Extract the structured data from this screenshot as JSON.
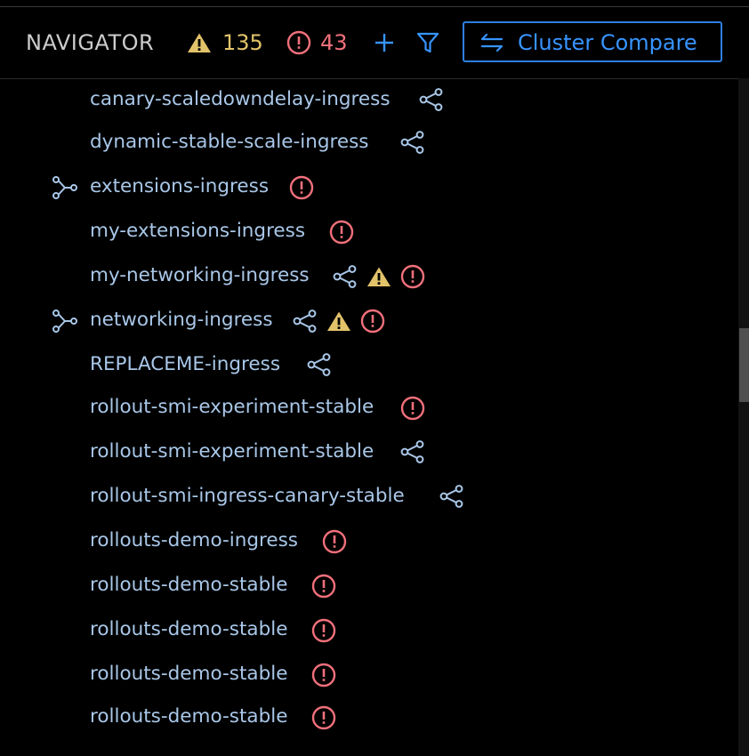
{
  "header": {
    "title": "NAVIGATOR",
    "warning_count": "135",
    "error_count": "43",
    "add_icon": "plus-icon",
    "filter_icon": "filter-icon",
    "cluster_compare_label": "Cluster Compare",
    "cluster_compare_icon": "swap-arrows-icon"
  },
  "colors": {
    "background": "#000000",
    "accent": "#3794ff",
    "warning": "#e2c36a",
    "error": "#f1707b",
    "item_text": "#a9c7e8",
    "title_text": "#cccccc"
  },
  "items": [
    {
      "label": "canary-scaledowndelay-ingress",
      "expandable": false,
      "icons": [
        "share-icon"
      ]
    },
    {
      "label": "dynamic-stable-scale-ingress",
      "expandable": false,
      "icons": [
        "share-icon"
      ]
    },
    {
      "label": "extensions-ingress",
      "expandable": true,
      "icons": [
        "error-icon"
      ]
    },
    {
      "label": "my-extensions-ingress",
      "expandable": false,
      "icons": [
        "error-icon"
      ]
    },
    {
      "label": "my-networking-ingress",
      "expandable": false,
      "icons": [
        "share-icon",
        "warning-icon",
        "error-icon"
      ]
    },
    {
      "label": "networking-ingress",
      "expandable": true,
      "icons": [
        "share-icon",
        "warning-icon",
        "error-icon"
      ]
    },
    {
      "label": "REPLACEME-ingress",
      "expandable": false,
      "icons": [
        "share-icon"
      ]
    },
    {
      "label": "rollout-smi-experiment-stable",
      "expandable": false,
      "icons": [
        "error-icon"
      ]
    },
    {
      "label": "rollout-smi-experiment-stable",
      "expandable": false,
      "icons": [
        "share-icon"
      ]
    },
    {
      "label": "rollout-smi-ingress-canary-stable",
      "expandable": false,
      "icons": [
        "share-icon"
      ]
    },
    {
      "label": "rollouts-demo-ingress",
      "expandable": false,
      "icons": [
        "error-icon"
      ]
    },
    {
      "label": "rollouts-demo-stable",
      "expandable": false,
      "icons": [
        "error-icon"
      ]
    },
    {
      "label": "rollouts-demo-stable",
      "expandable": false,
      "icons": [
        "error-icon"
      ]
    },
    {
      "label": "rollouts-demo-stable",
      "expandable": false,
      "icons": [
        "error-icon"
      ]
    },
    {
      "label": "rollouts-demo-stable",
      "expandable": false,
      "icons": [
        "error-icon"
      ]
    }
  ]
}
